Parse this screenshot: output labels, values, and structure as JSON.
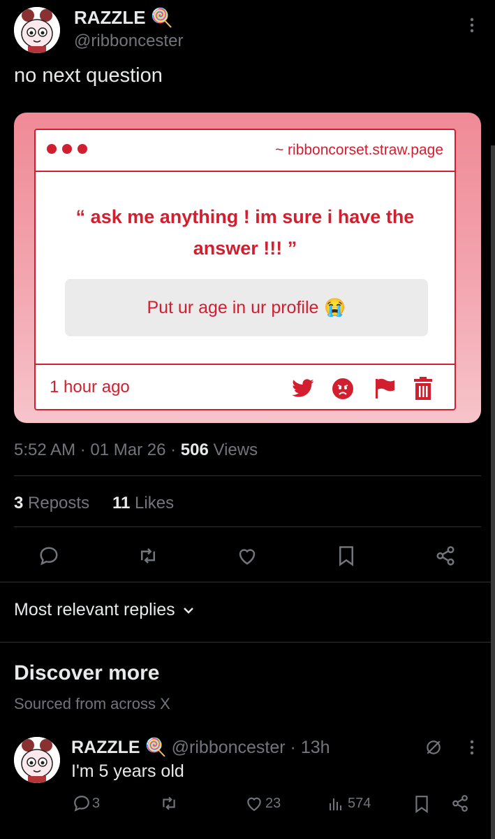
{
  "post": {
    "author_name": "RAZZLE",
    "author_emoji": "🍭",
    "handle": "@ribboncester",
    "text": "no next question",
    "timestamp": "5:52 AM · 01 Mar 26 · ",
    "views_count": "506",
    "views_label": " Views",
    "reposts_count": "3",
    "reposts_label": " Reposts",
    "likes_count": "11",
    "likes_label": " Likes"
  },
  "card": {
    "url": "~ ribboncorset.straw.page",
    "question": "“ ask me anything ! im sure i have the answer !!! ”",
    "answer": "Put ur age in ur profile",
    "answer_emoji": "😭",
    "time_ago": "1 hour ago",
    "accent_color": "#d21f2f"
  },
  "replies_sort": "Most relevant replies",
  "discover": {
    "title": "Discover more",
    "subtitle": "Sourced from across X"
  },
  "reply": {
    "author_name": "RAZZLE",
    "author_emoji": "🍭",
    "handle": "@ribboncester",
    "age": " · 13h",
    "text": "I'm 5 years old",
    "replies": "3",
    "likes": "23",
    "views": "574"
  },
  "icons": [
    "more-vertical-icon",
    "reply-icon",
    "repost-icon",
    "like-icon",
    "bookmark-icon",
    "share-icon",
    "chevron-down-icon",
    "grok-icon",
    "views-icon",
    "twitter-bird-icon",
    "angry-face-icon",
    "flag-icon",
    "trash-icon"
  ]
}
